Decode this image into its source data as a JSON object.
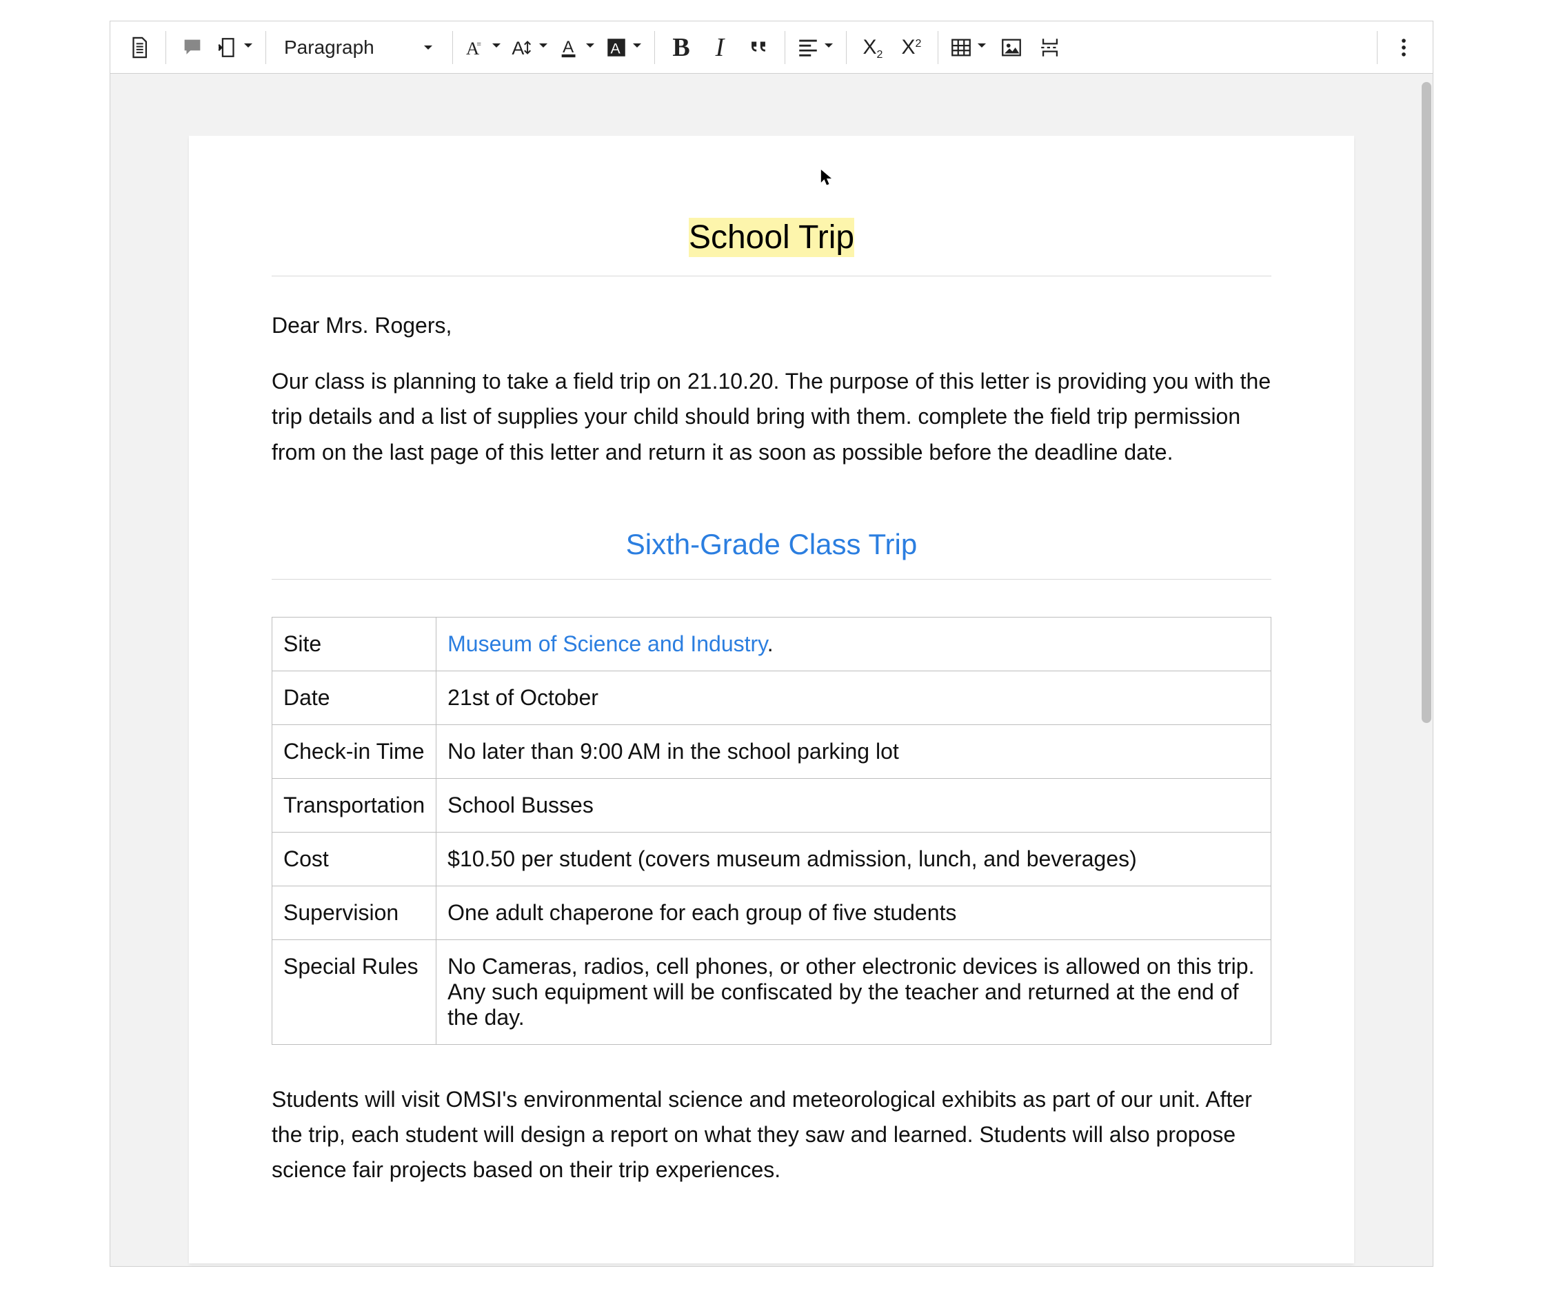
{
  "toolbar": {
    "paragraph_dropdown": "Paragraph"
  },
  "document": {
    "title": "School Trip",
    "greeting": "Dear Mrs. Rogers,",
    "intro": "Our class is planning to take a field trip on 21.10.20. The purpose of this letter is providing you with the trip details and a list of supplies your child should bring with them. complete the field trip permission from on the last page of this letter and return it as soon as possible before the deadline date.",
    "subheader": "Sixth-Grade Class Trip",
    "table": [
      {
        "label": "Site",
        "value_link": "Museum of Science and Industry",
        "value_suffix": "."
      },
      {
        "label": "Date",
        "value": "21st of October"
      },
      {
        "label": "Check-in Time",
        "value": "No later than 9:00 AM in the school parking lot"
      },
      {
        "label": "Transportation",
        "value": "School Busses"
      },
      {
        "label": "Cost",
        "value": "$10.50 per student (covers museum admission, lunch, and beverages)"
      },
      {
        "label": "Supervision",
        "value": "One adult chaperone for each group of five students"
      },
      {
        "label": "Special Rules",
        "value": "No Cameras, radios, cell phones, or other electronic devices is allowed on this trip. Any such equipment will be confiscated by the teacher and returned at the end of the day."
      }
    ],
    "para2": "Students will visit OMSI's environmental science and meteorological exhibits as part of our unit. After the trip, each student will design a report on what they saw and learned. Students will also propose science fair projects based on their trip experiences."
  }
}
